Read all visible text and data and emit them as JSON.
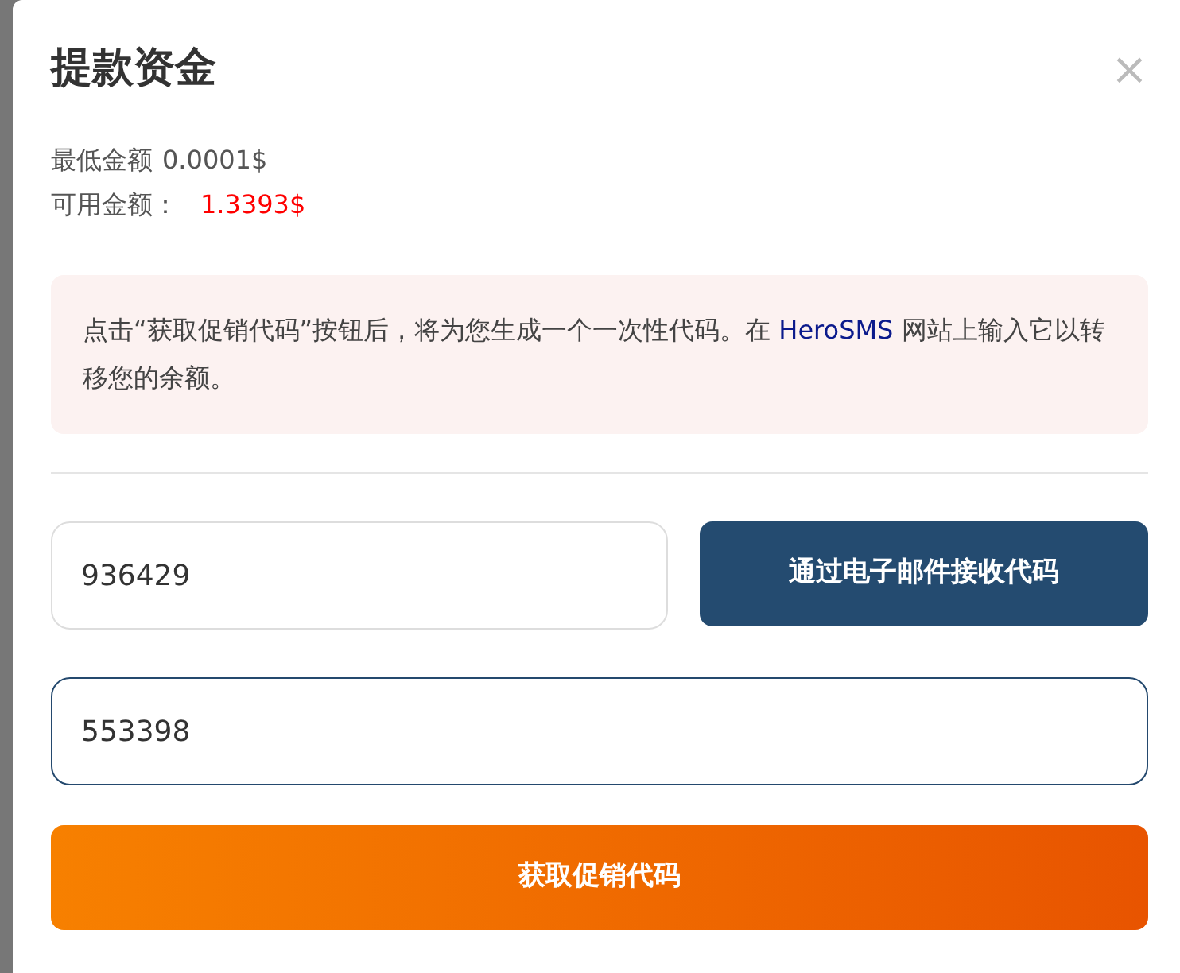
{
  "dialog": {
    "title": "提款资金",
    "close": "×",
    "min_amount": {
      "label": "最低金额",
      "value": "0.0001$"
    },
    "available": {
      "label": "可用金额：",
      "value": "1.3393$"
    },
    "notice": {
      "before": "点击“获取促销代码”按钮后，将为您生成一个一次性代码。在",
      "link": "HeroSMS",
      "after": "网站上输入它以转移您的余额。"
    },
    "code_field": {
      "value": "936429",
      "focused": false
    },
    "email_button": "通过电子邮件接收代码",
    "email_code_field": {
      "value": "553398",
      "focused": true
    },
    "submit_button": "获取促销代码"
  }
}
